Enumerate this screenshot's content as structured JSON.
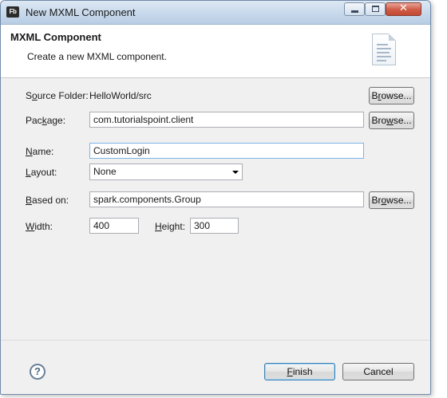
{
  "window": {
    "title": "New MXML Component",
    "app_icon_text": "Fb",
    "close_symbol": "✕"
  },
  "header": {
    "title": "MXML Component",
    "description": "Create a new MXML component."
  },
  "form": {
    "source_folder": {
      "label_pre": "S",
      "label_ul": "o",
      "label_post": "urce Folder:",
      "value": "HelloWorld/src",
      "browse": {
        "pre": "B",
        "ul": "r",
        "post": "owse..."
      }
    },
    "package": {
      "label_pre": "Pac",
      "label_ul": "k",
      "label_post": "age:",
      "value": "com.tutorialspoint.client",
      "browse": {
        "pre": "Bro",
        "ul": "w",
        "post": "se..."
      }
    },
    "name": {
      "label_pre": "",
      "label_ul": "N",
      "label_post": "ame:",
      "value": "CustomLogin"
    },
    "layout": {
      "label_pre": "",
      "label_ul": "L",
      "label_post": "ayout:",
      "value": "None"
    },
    "based_on": {
      "label_pre": "",
      "label_ul": "B",
      "label_post": "ased on:",
      "value": "spark.components.Group",
      "browse": {
        "pre": "Br",
        "ul": "o",
        "post": "wse..."
      }
    },
    "width": {
      "label_pre": "",
      "label_ul": "W",
      "label_post": "idth:",
      "value": "400"
    },
    "height": {
      "label_pre": "",
      "label_ul": "H",
      "label_post": "eight:",
      "value": "300"
    }
  },
  "footer": {
    "help_symbol": "?",
    "finish": {
      "pre": "",
      "ul": "F",
      "post": "inish"
    },
    "cancel_label": "Cancel"
  }
}
